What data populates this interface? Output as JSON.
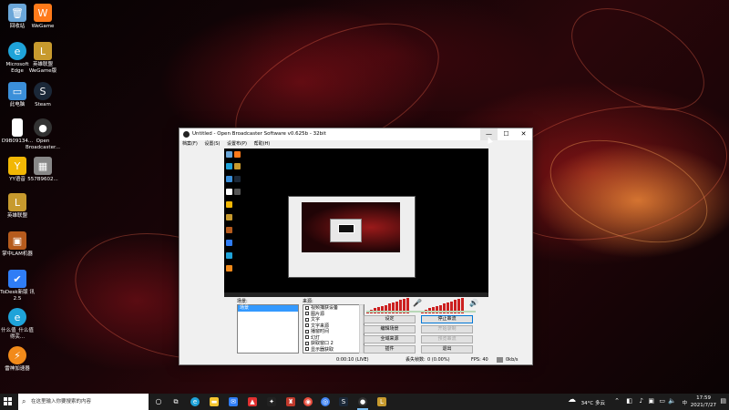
{
  "desktop": {
    "icons": [
      {
        "label": "回收站",
        "icon": "recycle-bin-icon",
        "color": "#6aa6d8"
      },
      {
        "label": "WeGame",
        "icon": "wegame-icon",
        "color": "#ff7a1a"
      },
      {
        "label": "Microsoft Edge",
        "icon": "edge-icon",
        "color": "#1fa3d9"
      },
      {
        "label": "英雄联盟 WeGame版",
        "icon": "lol-icon",
        "color": "#c79a2e"
      },
      {
        "label": "此电脑",
        "icon": "this-pc-icon",
        "color": "#3b8fd9"
      },
      {
        "label": "Steam",
        "icon": "steam-icon",
        "color": "#1b2838"
      },
      {
        "label": "D9B09134...",
        "icon": "file-icon",
        "color": "#ffffff"
      },
      {
        "label": "Open Broadcaster...",
        "icon": "obs-icon",
        "color": "#333333"
      },
      {
        "label": "YY语音",
        "icon": "yy-icon",
        "color": "#f2b705"
      },
      {
        "label": "557B9602...",
        "icon": "image-file-icon",
        "color": "#888888"
      },
      {
        "label": "英雄联盟",
        "icon": "league-icon",
        "color": "#c79a2e"
      },
      {
        "label": "掌中LAM机器",
        "icon": "lam-icon",
        "color": "#b65b1d"
      },
      {
        "label": "ToDesk新版 讯2.5",
        "icon": "todesk-icon",
        "color": "#2f7df6"
      },
      {
        "label": "什么值_什么值得买...",
        "icon": "edge-app-icon",
        "color": "#1fa3d9"
      },
      {
        "label": "雷神加速器",
        "icon": "leishen-icon",
        "color": "#f28a1a"
      }
    ]
  },
  "obs": {
    "title": "Untitled - Open Broadcaster Software v0.625b - 32bit",
    "window_controls": {
      "minimize": "—",
      "maximize": "☐",
      "close": "✕"
    },
    "menu": [
      "档案(F)",
      "设置(S)",
      "设置布(P)",
      "帮助(H)"
    ],
    "scenes_label": "场景:",
    "scenes": [
      "场景"
    ],
    "sources_label": "来源:",
    "sources": [
      "视频捕获设备",
      "图片源",
      "文字",
      "文字来源",
      "播窗时间",
      "幻灯",
      "获取窗口 2",
      "显示器获取"
    ],
    "buttons": {
      "settings": "设定",
      "start_stream": "停止串流",
      "edit_scene": "编辑场景",
      "start_record": "开始录制",
      "global_sources": "全域来源",
      "preview_stream": "预览串流",
      "plugins": "插件",
      "exit": "退出"
    },
    "status": {
      "time": "0:00:10 (LIVE)",
      "dropped_label": "丢失帧数:",
      "dropped_value": "0 (0.00%)",
      "fps": "FPS: 40",
      "bitrate": "0kb/s"
    }
  },
  "taskbar": {
    "search_placeholder": "在这里输入你要搜索的内容",
    "weather": "34°C 多云",
    "ime": "中",
    "time": "17:59",
    "date": "2021/7/27"
  }
}
